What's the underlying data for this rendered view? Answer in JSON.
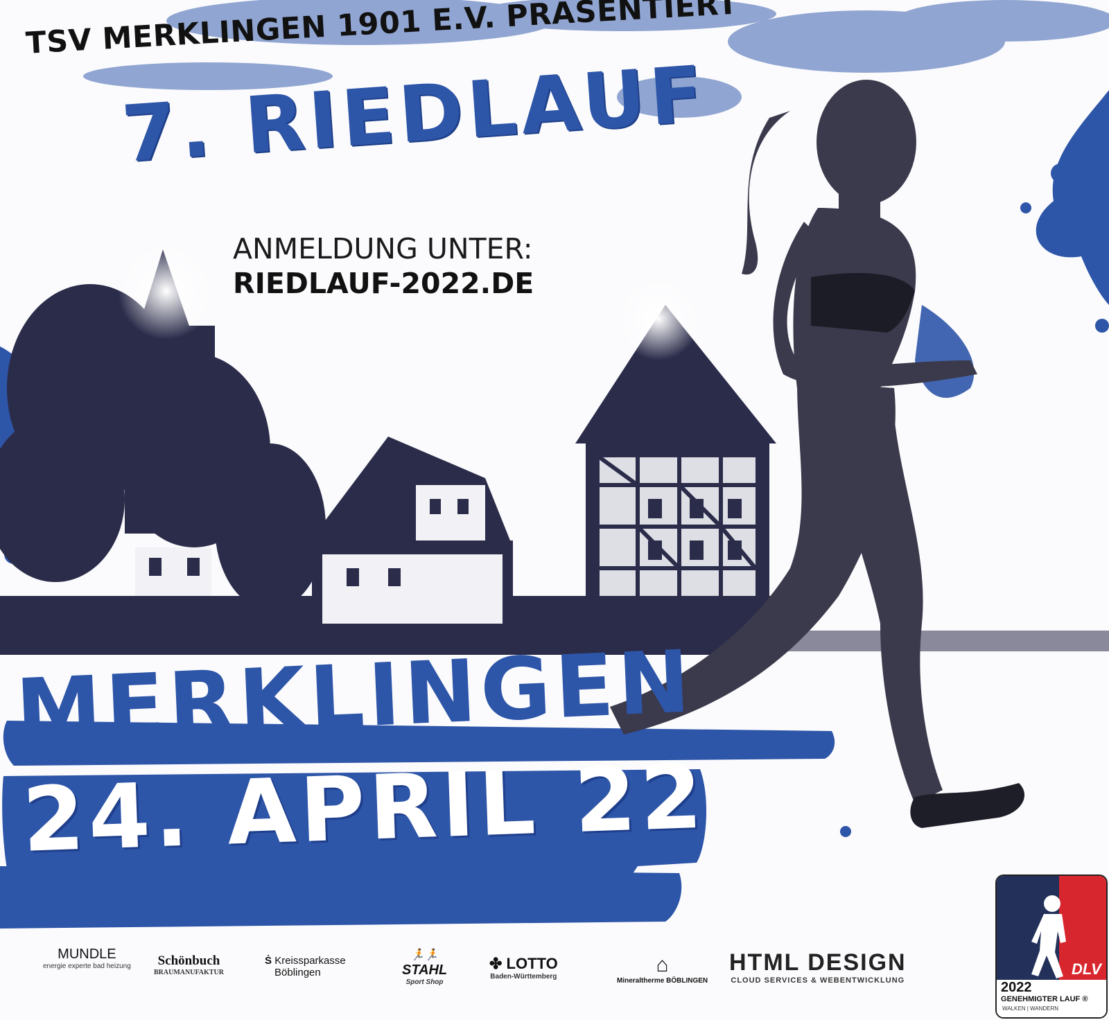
{
  "poster": {
    "presenter": "TSV MERKLINGEN 1901 E.V. PRÄSENTIERT",
    "title": "7. RIEDLAUF",
    "registration_label": "ANMELDUNG UNTER:",
    "registration_url": "RIEDLAUF-2022.DE",
    "town": "MERKLINGEN",
    "date": "24. APRIL 22"
  },
  "sponsors": {
    "mundle": "MUNDLE",
    "mundle_sub": "energie experte  bad heizung",
    "schoenbuch": "Schönbuch",
    "schoenbuch_sub": "BRAUMANUFAKTUR",
    "ksk_line1": "Kreissparkasse",
    "ksk_line2": "Böblingen",
    "stahl": "STAHL",
    "stahl_sub": "Sport Shop",
    "lotto": "LOTTO",
    "lotto_sub": "Baden-Württemberg",
    "mineral": "Mineraltherme BÖBLINGEN",
    "html_design": "HTML DESIGN",
    "html_design_sub": "CLOUD SERVICES & WEBENTWICKLUNG"
  },
  "badge": {
    "year": "2022",
    "line1": "GENEHMIGTER LAUF ®",
    "line2": "WALKEN | WANDERN",
    "mark": "DLV"
  },
  "colors": {
    "brand_blue": "#2d55a8",
    "dark_navy": "#2b2c4a",
    "badge_red": "#d8262e",
    "badge_navy": "#22305a"
  }
}
